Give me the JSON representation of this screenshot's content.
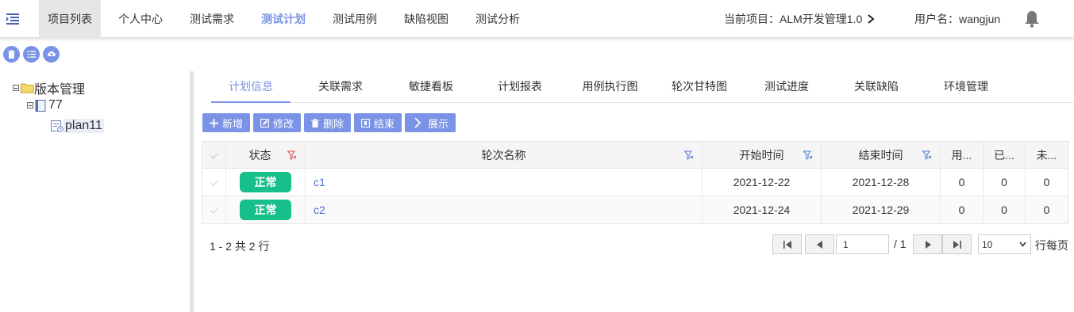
{
  "nav": {
    "items": [
      "项目列表",
      "个人中心",
      "测试需求",
      "测试计划",
      "测试用例",
      "缺陷视图",
      "测试分析"
    ],
    "project_label": "当前项目：ALM开发管理1.0",
    "username_label": "用户名：wangjun"
  },
  "tree": {
    "root": "版本管理",
    "child": "77",
    "leaf": "plan11"
  },
  "tabs": [
    "计划信息",
    "关联需求",
    "敏捷看板",
    "计划报表",
    "用例执行图",
    "轮次甘特图",
    "测试进度",
    "关联缺陷",
    "环境管理"
  ],
  "toolbar": {
    "add": "新增",
    "edit": "修改",
    "delete": "删除",
    "finish": "结束",
    "show": "展示"
  },
  "grid": {
    "headers": {
      "status": "状态",
      "name": "轮次名称",
      "start": "开始时间",
      "end": "结束时间",
      "used": "用...",
      "done": "已...",
      "pending": "未..."
    },
    "rows": [
      {
        "status": "正常",
        "name": "c1",
        "start": "2021-12-22",
        "end": "2021-12-28",
        "used": "0",
        "done": "0",
        "pending": "0"
      },
      {
        "status": "正常",
        "name": "c2",
        "start": "2021-12-24",
        "end": "2021-12-29",
        "used": "0",
        "done": "0",
        "pending": "0"
      }
    ]
  },
  "pager": {
    "row_info": "1 - 2 共 2 行",
    "current_page": "1",
    "total_pages": "/ 1",
    "page_size": "10",
    "page_size_label": "行每页"
  },
  "colors": {
    "accent": "#7b93e6",
    "status_green": "#17bf8a",
    "link": "#4a6cd4"
  }
}
